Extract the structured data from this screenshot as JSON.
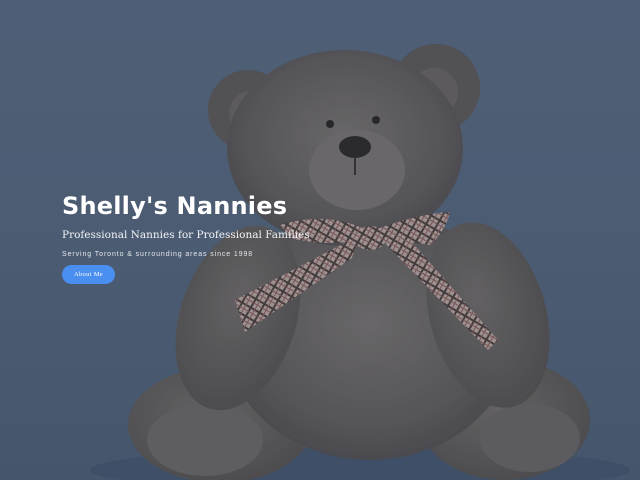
{
  "hero": {
    "title": "Shelly's Nannies",
    "subtitle": "Professional Nannies for Professional Families",
    "tagline": "Serving Toronto & surrounding areas since 1998",
    "cta_label": "About Me",
    "background_image": "teddy-bear-photo",
    "accent_color": "#4a8ef0"
  }
}
